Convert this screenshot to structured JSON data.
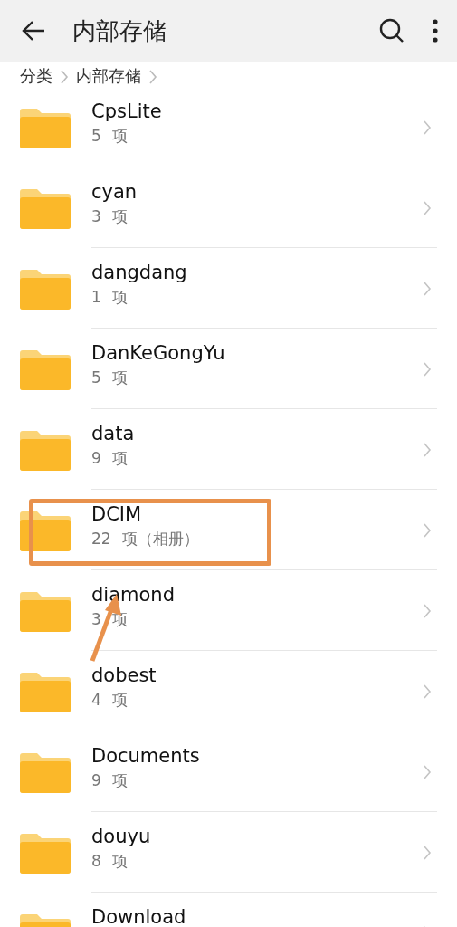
{
  "header": {
    "title": "内部存储"
  },
  "breadcrumb": [
    {
      "label": "分类"
    },
    {
      "label": "内部存储"
    }
  ],
  "folders": [
    {
      "name": "CpsLite",
      "count": "5 项",
      "highlighted": false,
      "arrow": false
    },
    {
      "name": "cyan",
      "count": "3 项",
      "highlighted": false,
      "arrow": false
    },
    {
      "name": "dangdang",
      "count": "1 项",
      "highlighted": false,
      "arrow": false
    },
    {
      "name": "DanKeGongYu",
      "count": "5 项",
      "highlighted": false,
      "arrow": false
    },
    {
      "name": "data",
      "count": "9 项",
      "highlighted": false,
      "arrow": false
    },
    {
      "name": "DCIM",
      "count": "22 项（相册）",
      "highlighted": true,
      "arrow": false
    },
    {
      "name": "diamond",
      "count": "3 项",
      "highlighted": false,
      "arrow": true
    },
    {
      "name": "dobest",
      "count": "4 项",
      "highlighted": false,
      "arrow": false
    },
    {
      "name": "Documents",
      "count": "9 项",
      "highlighted": false,
      "arrow": false
    },
    {
      "name": "douyu",
      "count": "8 项",
      "highlighted": false,
      "arrow": false
    },
    {
      "name": "Download",
      "highlighted": false,
      "arrow": false
    }
  ]
}
